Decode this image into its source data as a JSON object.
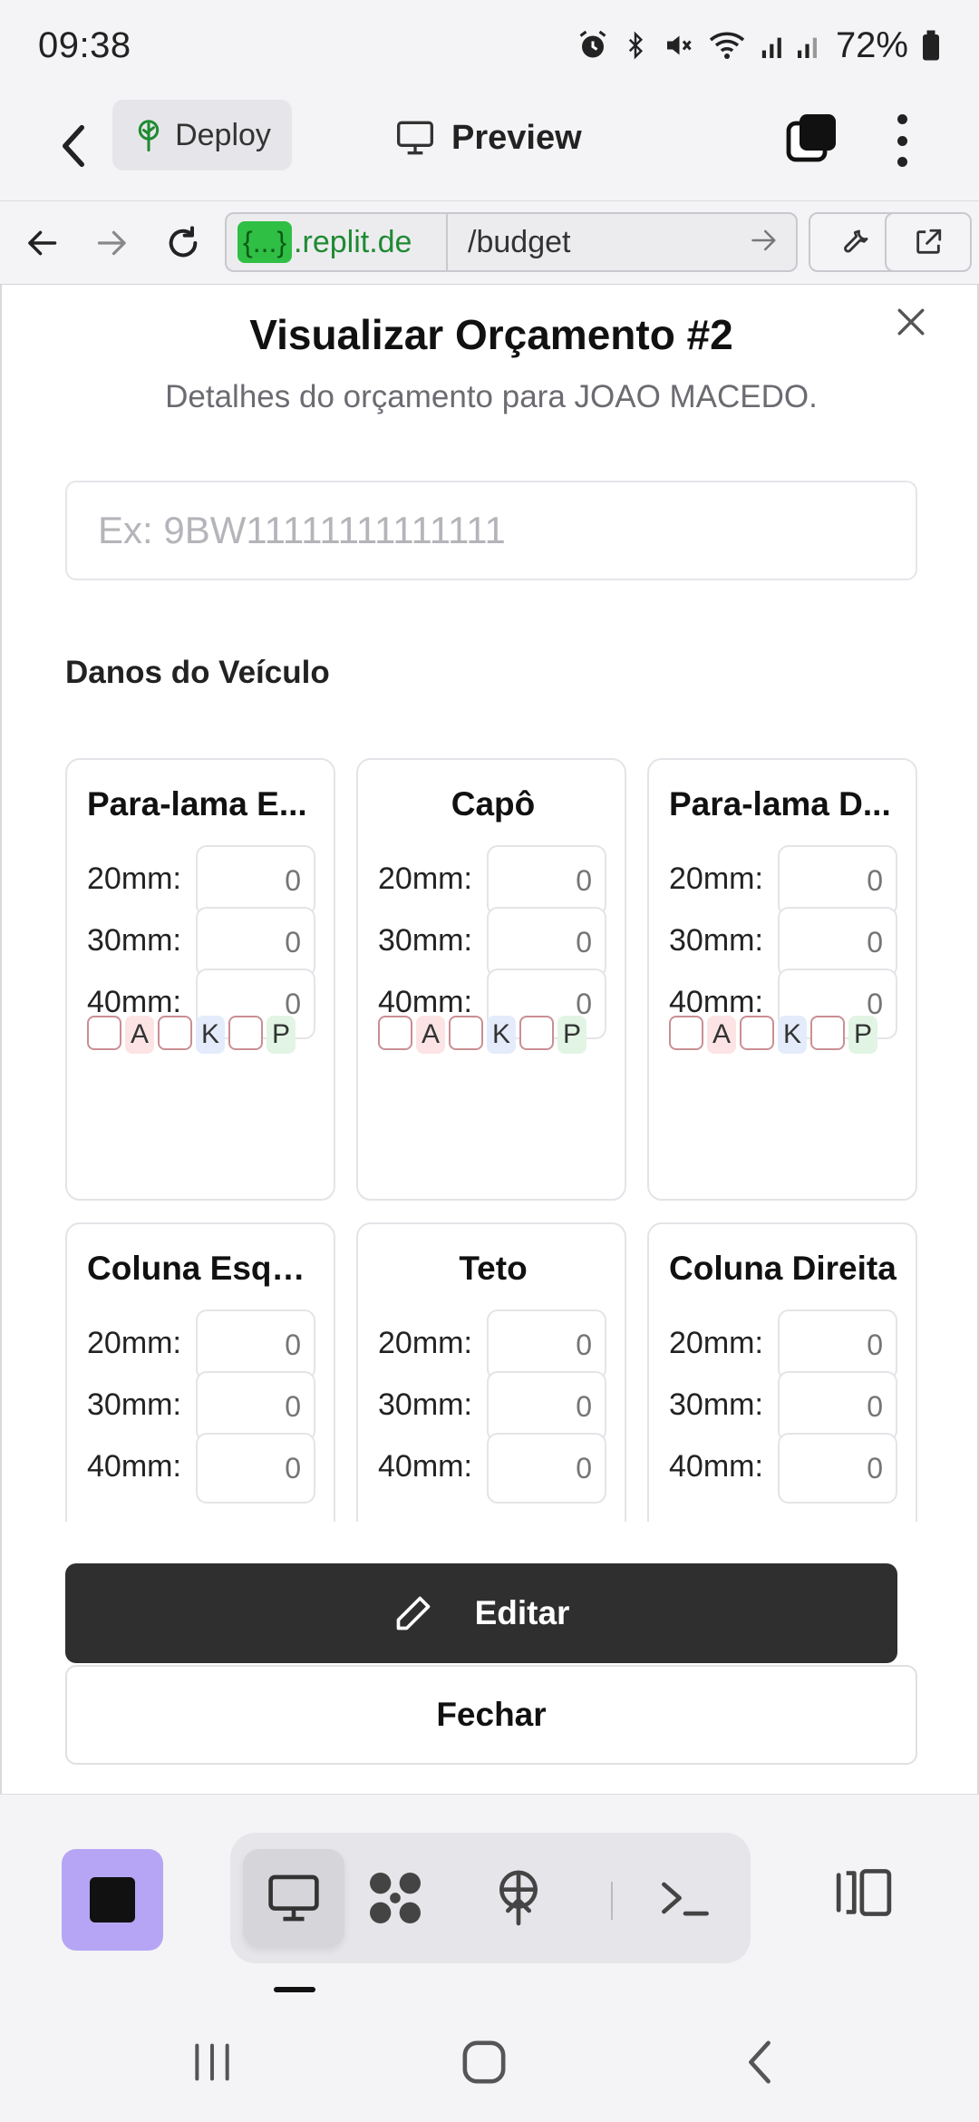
{
  "status_bar": {
    "time": "09:38",
    "battery": "72%"
  },
  "header": {
    "deploy_label": "Deploy",
    "preview_label": "Preview"
  },
  "browser": {
    "url_badge": "{...}",
    "url_host": ".replit.de",
    "url_path": "/budget"
  },
  "modal": {
    "title": "Visualizar Orçamento #2",
    "subtitle": "Detalhes do orçamento para JOAO MACEDO.",
    "vin_placeholder": "Ex: 9BW11111111111111",
    "section_title": "Danos do Veículo",
    "row_labels": [
      "20mm:",
      "30mm:",
      "40mm:"
    ],
    "flag_labels": [
      "A",
      "K",
      "P"
    ],
    "cards": [
      {
        "title": "Para-lama E...",
        "values": [
          "0",
          "0",
          "0"
        ]
      },
      {
        "title": "Capô",
        "values": [
          "0",
          "0",
          "0"
        ]
      },
      {
        "title": "Para-lama D...",
        "values": [
          "0",
          "0",
          "0"
        ]
      },
      {
        "title": "Coluna Esqu...",
        "values": [
          "0",
          "0",
          "0"
        ]
      },
      {
        "title": "Teto",
        "values": [
          "0",
          "0",
          "0"
        ]
      },
      {
        "title": "Coluna Direita",
        "values": [
          "0",
          "0",
          "0"
        ]
      }
    ],
    "edit_label": "Editar",
    "close_label": "Fechar"
  },
  "colors": {
    "accent_purple": "#b6a5f5",
    "edit_button": "#2f2f2f",
    "url_green": "#1f8a32"
  },
  "icons": [
    "alarm-icon",
    "bluetooth-icon",
    "mute-icon",
    "wifi-icon",
    "signal-icon",
    "battery-icon",
    "back-chevron-icon",
    "deploy-tree-icon",
    "monitor-icon",
    "tabs-icon",
    "kebab-menu-icon",
    "arrow-left-icon",
    "arrow-right-icon",
    "reload-icon",
    "wrench-icon",
    "external-link-icon",
    "close-icon",
    "pencil-icon",
    "stop-icon",
    "workspace-icon",
    "deploy-icon",
    "terminal-icon",
    "split-view-icon"
  ]
}
